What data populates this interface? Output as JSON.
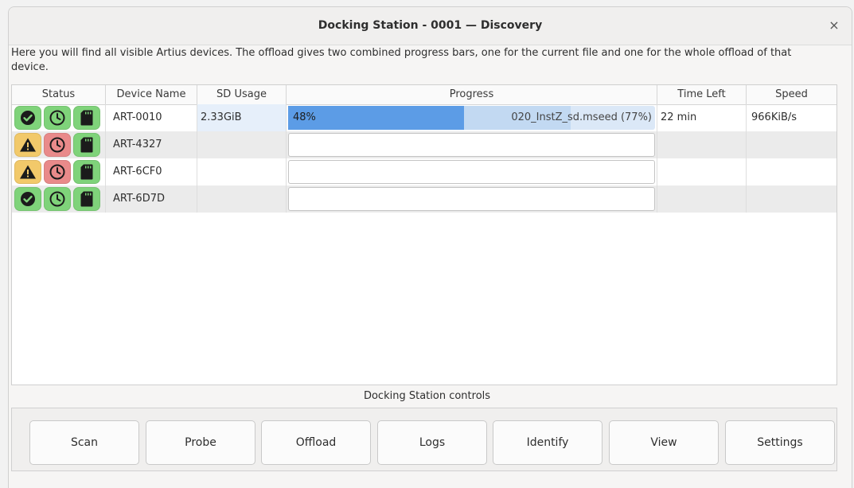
{
  "window": {
    "title": "Docking Station - 0001 — Discovery",
    "close_icon": "×"
  },
  "description": "Here you will find all visible Artius devices. The offload gives two combined progress bars, one for the current file and one for the whole offload of that device.",
  "table": {
    "headers": {
      "status": "Status",
      "device_name": "Device Name",
      "sd_usage": "SD Usage",
      "progress": "Progress",
      "time_left": "Time Left",
      "speed": "Speed"
    },
    "rows": [
      {
        "status": [
          "ok",
          "clock-ok",
          "sd-ok"
        ],
        "device_name": "ART-0010",
        "sd_usage": "2.33GiB",
        "progress_total_percent": 48,
        "progress_total_label": "48%",
        "progress_file_percent": 77,
        "progress_file_label": "020_InstZ_sd.mseed (77%)",
        "time_left": "22 min",
        "speed": "966KiB/s"
      },
      {
        "status": [
          "warning",
          "clock-error",
          "sd-ok"
        ],
        "device_name": "ART-4327",
        "sd_usage": "",
        "time_left": "",
        "speed": ""
      },
      {
        "status": [
          "warning",
          "clock-error",
          "sd-ok"
        ],
        "device_name": "ART-6CF0",
        "sd_usage": "",
        "time_left": "",
        "speed": ""
      },
      {
        "status": [
          "ok",
          "clock-ok",
          "sd-ok"
        ],
        "device_name": "ART-6D7D",
        "sd_usage": "",
        "time_left": "",
        "speed": ""
      }
    ]
  },
  "controls": {
    "label": "Docking Station controls",
    "buttons": [
      "Scan",
      "Probe",
      "Offload",
      "Logs",
      "Identify",
      "View",
      "Settings"
    ]
  },
  "colors": {
    "status_green": "#7fd37a",
    "status_yellow": "#f2c96a",
    "status_red": "#e98a8a",
    "progress_total": "#5c9ce6",
    "progress_file": "#c2d9f2"
  }
}
